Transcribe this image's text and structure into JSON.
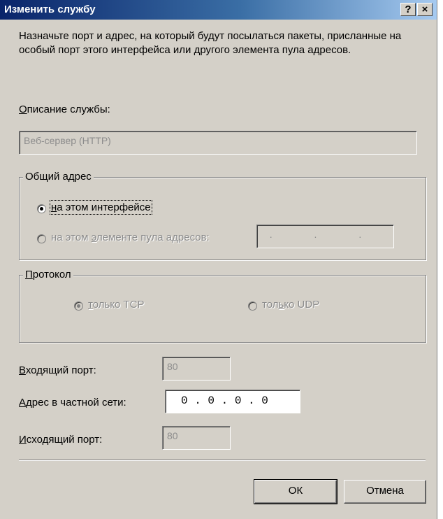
{
  "window": {
    "title": "Изменить службу",
    "help_button": "?",
    "close_button": "×"
  },
  "intro": "Назначьте порт и адрес, на который будут посылаться пакеты, присланные на особый порт этого интерфейса или другого элемента пула адресов.",
  "service_description": {
    "label_underlined": "О",
    "label_rest": "писание службы:",
    "value": "Веб-сервер (HTTP)"
  },
  "public_address": {
    "legend": "Общий адрес",
    "option_interface": {
      "u": "н",
      "rest": "а этом интерфейсе",
      "selected": true
    },
    "option_pool": {
      "pre": "на этом ",
      "u": "э",
      "rest": "лементе пула адресов:",
      "selected": false
    },
    "pool_ip_dots": ". . ."
  },
  "protocol": {
    "legend_u": "П",
    "legend_rest": "ротокол",
    "tcp": {
      "u": "т",
      "rest": "олько TCP",
      "selected": true
    },
    "udp": {
      "pre": "тол",
      "u": "ь",
      "rest": "ко UDP",
      "selected": false
    }
  },
  "incoming_port": {
    "u": "В",
    "rest": "ходящий порт:",
    "value": "80"
  },
  "private_address": {
    "u": "А",
    "rest": "дрес в частной сети:",
    "value": "0 . 0 . 0 . 0"
  },
  "outgoing_port": {
    "u": "И",
    "rest": "сходящий порт:",
    "value": "80"
  },
  "buttons": {
    "ok": "ОК",
    "cancel": "Отмена"
  }
}
